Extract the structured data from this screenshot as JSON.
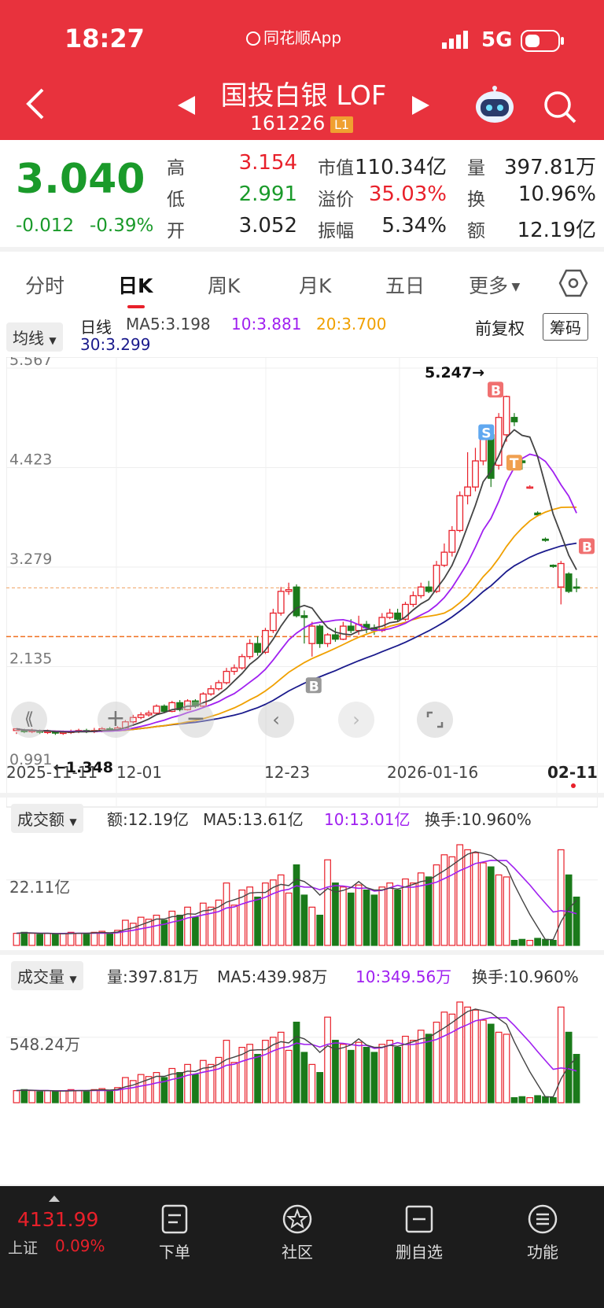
{
  "status_bar": {
    "time": "18:27",
    "app": "同花顺App",
    "network": "5G"
  },
  "header": {
    "title": "国投白银 LOF",
    "code": "161226",
    "badge": "L1"
  },
  "quote": {
    "price": "3.040",
    "change": "-0.012",
    "change_pct": "-0.39%",
    "stats": [
      {
        "label": "高",
        "value": "3.154",
        "color": "#e8202a"
      },
      {
        "label": "低",
        "value": "2.991",
        "color": "#1a9a2a"
      },
      {
        "label": "开",
        "value": "3.052",
        "color": "#222222"
      },
      {
        "label": "市值",
        "value": "110.34亿",
        "color": "#222222"
      },
      {
        "label": "溢价",
        "value": "35.03%",
        "color": "#e8202a"
      },
      {
        "label": "振幅",
        "value": "5.34%",
        "color": "#222222"
      },
      {
        "label": "量",
        "value": "397.81万",
        "color": "#222222"
      },
      {
        "label": "换",
        "value": "10.96%",
        "color": "#222222"
      },
      {
        "label": "额",
        "value": "12.19亿",
        "color": "#222222"
      }
    ]
  },
  "tabs": [
    "分时",
    "日K",
    "周K",
    "月K",
    "五日",
    "更多"
  ],
  "kline": {
    "indicator_select": "均线",
    "period": "日线",
    "ma5": "MA5:3.198",
    "ma10": "10:3.881",
    "ma20": "20:3.700",
    "ma30": "30:3.299",
    "adjust": "前复权",
    "chips_button": "筹码",
    "max_label": "5.247→",
    "min_label": "←1.348",
    "y_ticks": [
      "5.567",
      "4.423",
      "3.279",
      "2.135",
      "0.991"
    ],
    "x_ticks": [
      "2025-11-11",
      "12-01",
      "12-23",
      "2026-01-16",
      "02-11"
    ]
  },
  "amount": {
    "select": "成交额",
    "value": "额:12.19亿",
    "ma5": "MA5:13.61亿",
    "ma10": "10:13.01亿",
    "turnover": "换手:10.960%",
    "y_label": "22.11亿"
  },
  "volume": {
    "select": "成交量",
    "value": "量:397.81万",
    "ma5": "MA5:439.98万",
    "ma10": "10:349.56万",
    "turnover": "换手:10.960%",
    "y_label": "548.24万"
  },
  "bottom_bar": {
    "index_value": "4131.99",
    "index_name": "上证",
    "index_change": "0.09%",
    "items": [
      "下单",
      "社区",
      "删自选",
      "功能"
    ]
  },
  "chart_data": {
    "type": "candlestick",
    "x_start": "2025-11-11",
    "x_end": "2026-02-11",
    "ylim": [
      0.991,
      5.567
    ],
    "candles": [
      [
        1.4,
        1.42,
        1.38,
        1.36
      ],
      [
        1.4,
        1.39,
        1.42,
        1.37
      ],
      [
        1.39,
        1.4,
        1.42,
        1.37
      ],
      [
        1.4,
        1.38,
        1.41,
        1.36
      ],
      [
        1.38,
        1.39,
        1.41,
        1.36
      ],
      [
        1.39,
        1.37,
        1.4,
        1.35
      ],
      [
        1.37,
        1.38,
        1.4,
        1.35
      ],
      [
        1.38,
        1.39,
        1.41,
        1.36
      ],
      [
        1.39,
        1.4,
        1.42,
        1.37
      ],
      [
        1.4,
        1.39,
        1.42,
        1.37
      ],
      [
        1.39,
        1.4,
        1.43,
        1.37
      ],
      [
        1.4,
        1.42,
        1.44,
        1.38
      ],
      [
        1.42,
        1.41,
        1.44,
        1.39
      ],
      [
        1.41,
        1.43,
        1.45,
        1.39
      ],
      [
        1.43,
        1.5,
        1.52,
        1.42
      ],
      [
        1.5,
        1.55,
        1.58,
        1.48
      ],
      [
        1.55,
        1.58,
        1.61,
        1.53
      ],
      [
        1.58,
        1.6,
        1.63,
        1.56
      ],
      [
        1.6,
        1.68,
        1.7,
        1.58
      ],
      [
        1.68,
        1.62,
        1.7,
        1.6
      ],
      [
        1.62,
        1.72,
        1.74,
        1.61
      ],
      [
        1.72,
        1.64,
        1.75,
        1.62
      ],
      [
        1.64,
        1.74,
        1.76,
        1.63
      ],
      [
        1.74,
        1.68,
        1.76,
        1.66
      ],
      [
        1.68,
        1.82,
        1.84,
        1.67
      ],
      [
        1.82,
        1.88,
        1.92,
        1.8
      ],
      [
        1.88,
        1.95,
        1.98,
        1.86
      ],
      [
        1.95,
        2.08,
        2.12,
        1.93
      ],
      [
        2.08,
        2.12,
        2.16,
        2.04
      ],
      [
        2.12,
        2.25,
        2.28,
        2.1
      ],
      [
        2.25,
        2.4,
        2.45,
        2.22
      ],
      [
        2.4,
        2.3,
        2.48,
        2.26
      ],
      [
        2.3,
        2.55,
        2.58,
        2.28
      ],
      [
        2.55,
        2.75,
        2.8,
        2.52
      ],
      [
        2.75,
        3.0,
        3.05,
        2.72
      ],
      [
        3.0,
        3.02,
        3.1,
        2.96
      ],
      [
        3.05,
        2.72,
        3.08,
        2.7
      ],
      [
        2.72,
        2.7,
        2.78,
        2.4
      ],
      [
        2.4,
        2.6,
        2.65,
        2.25
      ],
      [
        2.6,
        2.4,
        2.62,
        2.35
      ],
      [
        2.4,
        2.5,
        2.52,
        2.36
      ],
      [
        2.5,
        2.45,
        2.58,
        2.42
      ],
      [
        2.45,
        2.6,
        2.65,
        2.44
      ],
      [
        2.6,
        2.55,
        2.68,
        2.52
      ],
      [
        2.55,
        2.62,
        2.72,
        2.5
      ],
      [
        2.62,
        2.58,
        2.66,
        2.52
      ],
      [
        2.58,
        2.55,
        2.62,
        2.5
      ],
      [
        2.55,
        2.7,
        2.75,
        2.53
      ],
      [
        2.7,
        2.75,
        2.8,
        2.68
      ],
      [
        2.75,
        2.68,
        2.8,
        2.66
      ],
      [
        2.68,
        2.85,
        2.88,
        2.66
      ],
      [
        2.85,
        2.95,
        3.0,
        2.82
      ],
      [
        2.95,
        3.05,
        3.1,
        2.92
      ],
      [
        3.05,
        3.0,
        3.12,
        2.98
      ],
      [
        3.0,
        3.3,
        3.35,
        2.98
      ],
      [
        3.3,
        3.45,
        3.55,
        3.28
      ],
      [
        3.45,
        3.7,
        3.75,
        3.4
      ],
      [
        3.7,
        4.1,
        4.15,
        3.68
      ],
      [
        4.1,
        4.2,
        4.6,
        4.0
      ],
      [
        4.2,
        4.5,
        4.65,
        4.15
      ],
      [
        4.5,
        4.8,
        4.85,
        4.45
      ],
      [
        4.8,
        4.3,
        4.9,
        4.2
      ],
      [
        4.45,
        5.0,
        5.05,
        4.4
      ],
      [
        4.8,
        5.24,
        5.25,
        4.72
      ],
      [
        5.0,
        4.95,
        5.05,
        4.9
      ],
      [
        4.5,
        4.48,
        4.52,
        4.4
      ],
      [
        4.2,
        4.2,
        4.22,
        4.18
      ],
      [
        3.9,
        3.88,
        3.92,
        3.86
      ],
      [
        3.6,
        3.59,
        3.62,
        3.57
      ],
      [
        3.3,
        3.29,
        3.31,
        3.27
      ],
      [
        3.05,
        3.32,
        3.35,
        2.85
      ],
      [
        3.2,
        3.0,
        3.22,
        2.98
      ],
      [
        3.05,
        3.04,
        3.15,
        2.99
      ]
    ],
    "ma_colors": {
      "ma5": "#444444",
      "ma10": "#a020f0",
      "ma20": "#f0a000",
      "ma30": "#1a1a8c"
    }
  }
}
